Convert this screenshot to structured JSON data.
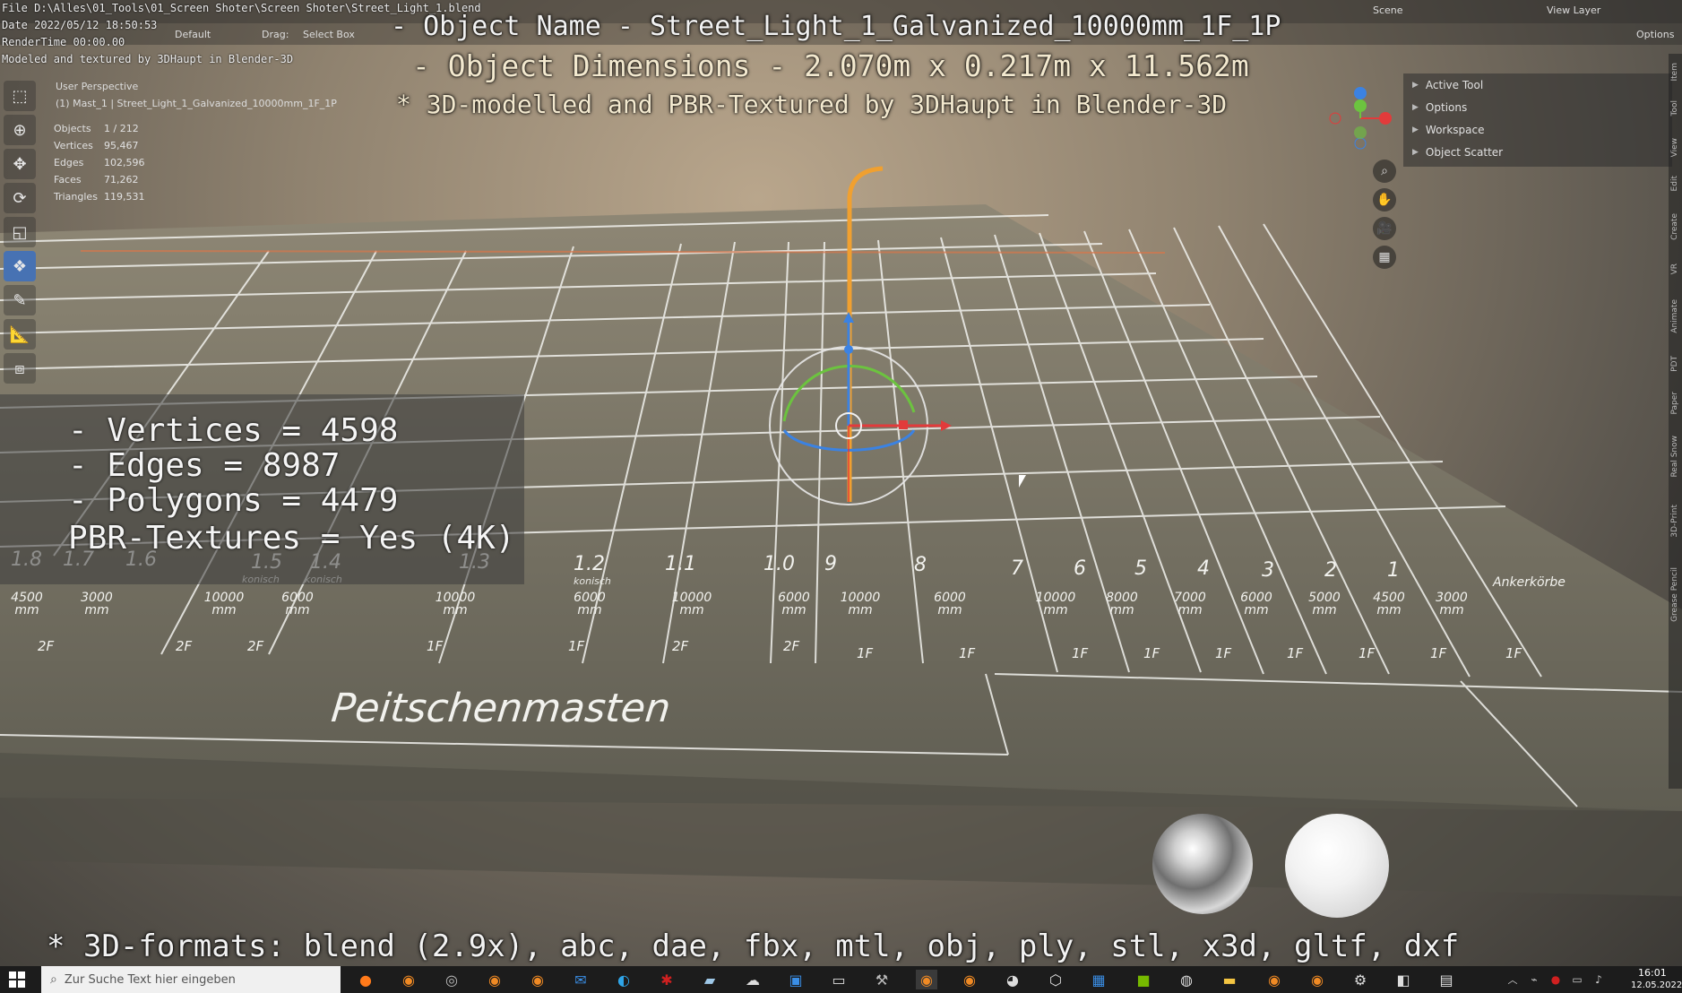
{
  "overlay": {
    "title_line1": "- Object Name - Street_Light_1_Galvanized_10000mm_1F_1P",
    "title_line2": "- Object Dimensions -  2.070m x 0.217m x 11.562m",
    "title_line3": "* 3D-modelled and PBR-Textured by 3DHaupt in Blender-3D",
    "formats": "* 3D-formats: blend (2.9x), abc, dae, fbx, mtl, obj, ply, stl, x3d, gltf, dxf",
    "stats": {
      "vertices": "- Vertices = 4598",
      "edges": "- Edges = 8987",
      "polygons": "- Polygons = 4479",
      "pbr": "PBR-Textures =  Yes (4K)"
    }
  },
  "render_info": {
    "file": "File D:\\Alles\\01_Tools\\01_Screen Shoter\\Screen Shoter\\Street_Light_1.blend",
    "date": "Date 2022/05/12 18:50:53",
    "render_time": "RenderTime 00:00.00",
    "credit": "Modeled and textured by 3DHaupt in Blender-3D"
  },
  "header": {
    "orientation_label": "Default",
    "drag_label": "Drag:",
    "drag_value": "Select Box",
    "scene": "Scene",
    "view_layer": "View Layer",
    "options": "Options"
  },
  "viewport": {
    "perspective": "User Perspective",
    "collection": "(1) Mast_1 | Street_Light_1_Galvanized_10000mm_1F_1P",
    "stats": [
      {
        "k": "Objects",
        "v": "1 / 212"
      },
      {
        "k": "Vertices",
        "v": "95,467"
      },
      {
        "k": "Edges",
        "v": "102,596"
      },
      {
        "k": "Faces",
        "v": "71,262"
      },
      {
        "k": "Triangles",
        "v": "119,531"
      }
    ]
  },
  "right_panel": {
    "items": [
      "Active Tool",
      "Options",
      "Workspace",
      "Object Scatter"
    ]
  },
  "sidebar_tabs": [
    "Item",
    "Tool",
    "View",
    "Edit",
    "Create",
    "VR",
    "Animate",
    "PDT",
    "Paper",
    "Real Snow",
    "3D-Print",
    "Grease Pencil"
  ],
  "floor_labels": {
    "main": "Peitschenmasten",
    "right": "Ankerkörbe",
    "numbers": [
      "1.8",
      "1.7",
      "1.6",
      "1.5",
      "1.4",
      "1.3",
      "1.2",
      "1.1",
      "1.0",
      "9",
      "8",
      "7",
      "6",
      "5",
      "4",
      "3",
      "2",
      "1"
    ],
    "lengths": [
      "4500 mm",
      "3000 mm",
      "10000 mm",
      "6000 mm",
      "10000 mm",
      "6000 mm",
      "10000 mm",
      "6000 mm",
      "10000 mm",
      "6000 mm",
      "10000 mm",
      "8000 mm",
      "7000 mm",
      "6000 mm",
      "5000 mm",
      "4500 mm",
      "3000 mm"
    ],
    "floors": [
      "2F",
      "2F",
      "2F",
      "1F",
      "1F",
      "2F",
      "2F",
      "1F",
      "1F",
      "1F",
      "1F",
      "1F",
      "1F",
      "1F",
      "1F",
      "1F"
    ],
    "konisch": "konisch"
  },
  "taskbar": {
    "search_placeholder": "Zur Suche Text hier eingeben",
    "time": "16:01",
    "date": "12.05.2022"
  },
  "colors": {
    "accent_active_tool": "#4772b3",
    "axis_x": "#e23b3b",
    "axis_y": "#6cc33f",
    "axis_z": "#3b82e2",
    "selection_orange": "#f0a030"
  }
}
